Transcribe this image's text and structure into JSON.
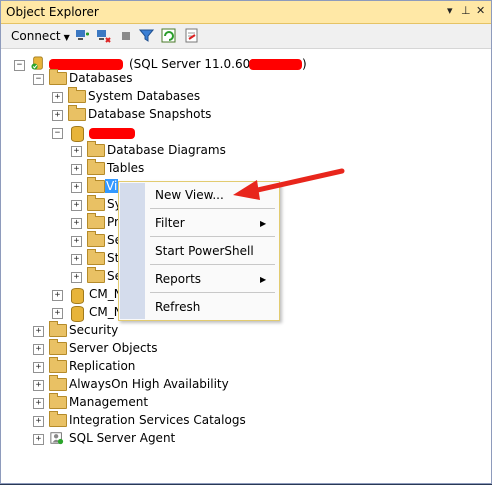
{
  "window": {
    "title": "Object Explorer",
    "controls": [
      "▾",
      "⊥",
      "✕"
    ]
  },
  "toolbar": {
    "connect_label": "Connect",
    "icons": [
      "connect-icon",
      "disconnect-icon",
      "stop-icon",
      "filter-icon",
      "refresh-icon",
      "activity-monitor-icon"
    ]
  },
  "tree": {
    "server_suffix": "(SQL Server 11.0.6020 -",
    "server_close": ")",
    "databases": "Databases",
    "system_databases": "System Databases",
    "database_snapshots": "Database Snapshots",
    "database_diagrams": "Database Diagrams",
    "tables": "Tables",
    "views_partial": "Vi",
    "synonyms_partial": "Sy",
    "programmability_partial": "Pr",
    "service_broker_partial": "Se",
    "storage_partial": "St",
    "security_partial": "Se",
    "cm1": "CM_N",
    "cm2": "CM_N",
    "security": "Security",
    "server_objects": "Server Objects",
    "replication": "Replication",
    "alwayson": "AlwaysOn High Availability",
    "management": "Management",
    "integration": "Integration Services Catalogs",
    "agent": "SQL Server Agent"
  },
  "context_menu": {
    "new_view": "New View...",
    "filter": "Filter",
    "start_powershell": "Start PowerShell",
    "reports": "Reports",
    "refresh": "Refresh",
    "submenu_glyph": "▶"
  },
  "colors": {
    "title_bg": "#ffe8a6",
    "redaction": "#ff0000",
    "arrow": "#e8261c"
  }
}
